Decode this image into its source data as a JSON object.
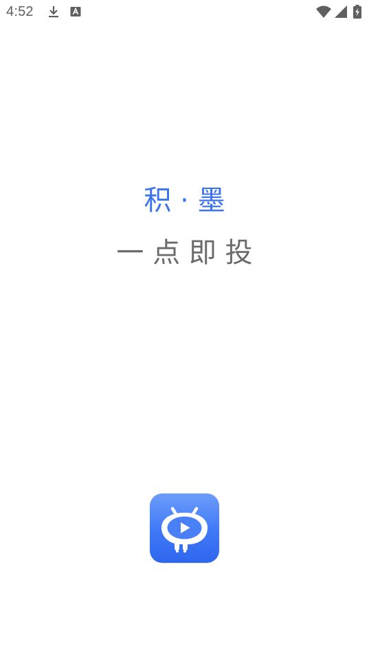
{
  "status_bar": {
    "time": "4:52",
    "icons": [
      "download-icon",
      "notification-a-icon",
      "wifi-icon",
      "signal-icon",
      "battery-charging-icon"
    ]
  },
  "splash": {
    "brand": "积 · 墨",
    "slogan": "一 点 即 投"
  },
  "logo": {
    "icon": "app-logo-icon",
    "colors": {
      "gradient_top": "#6d9dfb",
      "gradient_bottom": "#2f66ef",
      "glyph": "#ffffff"
    }
  },
  "colors": {
    "brand_text": "#3a72f0",
    "slogan_text": "#6b6b6b",
    "status_icons": "#5f5f5f",
    "background": "#ffffff"
  }
}
